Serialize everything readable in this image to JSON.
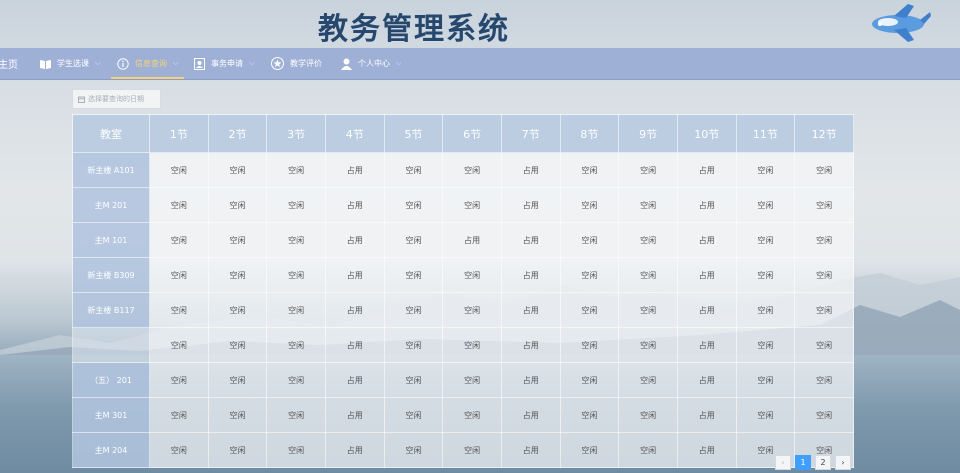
{
  "app": {
    "title": "教务管理系统"
  },
  "nav": {
    "home": "主页",
    "items": [
      {
        "label": "学生选课",
        "icon": "book-icon",
        "has_menu": true
      },
      {
        "label": "信息查询",
        "icon": "info-icon",
        "has_menu": true,
        "active": true
      },
      {
        "label": "事务申请",
        "icon": "contact-card-icon",
        "has_menu": true
      },
      {
        "label": "教学评价",
        "icon": "star-badge-icon",
        "has_menu": false
      },
      {
        "label": "个人中心",
        "icon": "user-icon",
        "has_menu": true
      }
    ]
  },
  "date_picker": {
    "placeholder": "选择要查询的日期"
  },
  "table": {
    "corner": "教室",
    "periods": [
      "1节",
      "2节",
      "3节",
      "4节",
      "5节",
      "6节",
      "7节",
      "8节",
      "9节",
      "10节",
      "11节",
      "12节"
    ],
    "rows": [
      {
        "room": "新主楼 A101",
        "status": [
          "空闲",
          "空闲",
          "空闲",
          "占用",
          "空闲",
          "空闲",
          "占用",
          "空闲",
          "空闲",
          "占用",
          "空闲",
          "空闲"
        ]
      },
      {
        "room": "主M 201",
        "status": [
          "空闲",
          "空闲",
          "空闲",
          "占用",
          "空闲",
          "空闲",
          "占用",
          "空闲",
          "空闲",
          "占用",
          "空闲",
          "空闲"
        ]
      },
      {
        "room": "主M 101",
        "status": [
          "空闲",
          "空闲",
          "空闲",
          "占用",
          "空闲",
          "占用",
          "占用",
          "空闲",
          "空闲",
          "占用",
          "空闲",
          "空闲"
        ]
      },
      {
        "room": "新主楼 B309",
        "status": [
          "空闲",
          "空闲",
          "空闲",
          "占用",
          "空闲",
          "空闲",
          "占用",
          "空闲",
          "空闲",
          "占用",
          "空闲",
          "空闲"
        ]
      },
      {
        "room": "新主楼 B117",
        "status": [
          "空闲",
          "空闲",
          "空闲",
          "占用",
          "空闲",
          "空闲",
          "占用",
          "空闲",
          "空闲",
          "占用",
          "空闲",
          "空闲"
        ]
      },
      {
        "room": "",
        "status": [
          "空闲",
          "空闲",
          "空闲",
          "占用",
          "空闲",
          "空闲",
          "占用",
          "空闲",
          "空闲",
          "占用",
          "空闲",
          "空闲"
        ]
      },
      {
        "room": "（五） 201",
        "status": [
          "空闲",
          "空闲",
          "空闲",
          "占用",
          "空闲",
          "空闲",
          "占用",
          "空闲",
          "空闲",
          "占用",
          "空闲",
          "空闲"
        ]
      },
      {
        "room": "主M 301",
        "status": [
          "空闲",
          "空闲",
          "空闲",
          "占用",
          "空闲",
          "空闲",
          "占用",
          "空闲",
          "空闲",
          "占用",
          "空闲",
          "空闲"
        ]
      },
      {
        "room": "主M 204",
        "status": [
          "空闲",
          "空闲",
          "空闲",
          "占用",
          "空闲",
          "空闲",
          "占用",
          "空闲",
          "空闲",
          "占用",
          "空闲",
          "空闲"
        ]
      }
    ]
  },
  "pagination": {
    "prev": "‹",
    "pages": [
      "1",
      "2"
    ],
    "current": "1",
    "next": "›"
  },
  "colors": {
    "nav_bg": "#9fb0d6",
    "active": "#f4d27a",
    "title": "#27486e",
    "header_cell": "#b9cbe1",
    "page_current": "#409eff"
  }
}
